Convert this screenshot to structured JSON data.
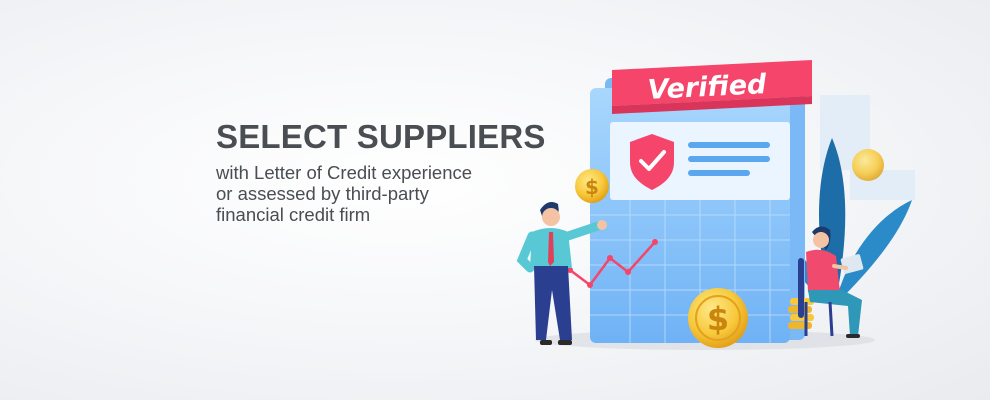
{
  "banner": {
    "headline": "SELECT SUPPLIERS",
    "subtitle_lines": [
      "with Letter of Credit experience",
      "or assessed by third-party",
      "financial credit firm"
    ]
  },
  "illustration": {
    "badge_label": "Verified",
    "coin_symbol": "$",
    "icons": [
      "shield-check-icon",
      "dollar-coin-icon",
      "trend-line-icon",
      "leaf-plant-icon"
    ],
    "colors": {
      "accent_red": "#f5456a",
      "panel_blue": "#9fd0fb",
      "coin_gold": "#f7c83a",
      "text_gray": "#4a4d52"
    }
  }
}
